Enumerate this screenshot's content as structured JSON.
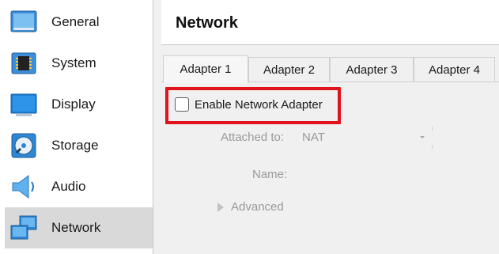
{
  "sidebar": {
    "items": [
      {
        "label": "General",
        "icon": "monitor-icon"
      },
      {
        "label": "System",
        "icon": "chip-icon"
      },
      {
        "label": "Display",
        "icon": "display-icon"
      },
      {
        "label": "Storage",
        "icon": "disc-icon"
      },
      {
        "label": "Audio",
        "icon": "speaker-icon"
      },
      {
        "label": "Network",
        "icon": "network-icon",
        "selected": true
      }
    ]
  },
  "header": {
    "title": "Network"
  },
  "tabs": [
    {
      "label": "Adapter 1",
      "active": true
    },
    {
      "label": "Adapter 2"
    },
    {
      "label": "Adapter 3"
    },
    {
      "label": "Adapter 4"
    }
  ],
  "adapter": {
    "enable_label": "Enable Network Adapter",
    "enabled": false,
    "attached_label": "Attached to:",
    "attached_value": "NAT",
    "name_label": "Name:",
    "advanced_label": "Advanced"
  },
  "colors": {
    "highlight": "#e0121b",
    "accent": "#1e88e5",
    "selected_item_bg": "#d9d9d9",
    "disabled_text": "#9a9a9a"
  }
}
